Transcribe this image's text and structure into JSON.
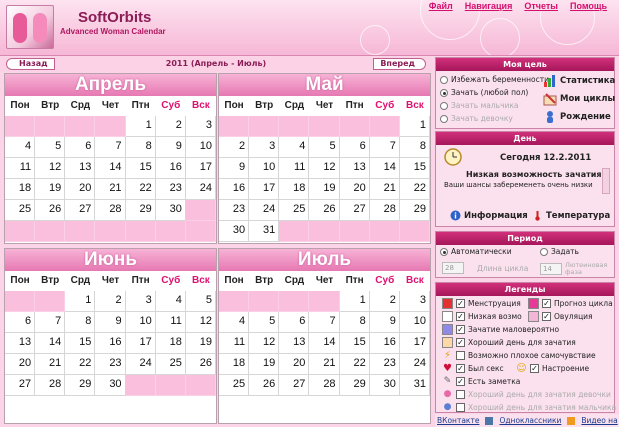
{
  "header": {
    "brand": "SoftOrbits",
    "subtitle": "Advanced Woman Calendar",
    "menu": [
      "Файл",
      "Навигация",
      "Отчеты",
      "Помощь"
    ]
  },
  "nav": {
    "back": "Назад",
    "forward": "Вперед",
    "title": "2011 (Апрель - Июль)"
  },
  "weekdays": [
    "Пон",
    "Втр",
    "Срд",
    "Чет",
    "Птн",
    "Суб",
    "Вск"
  ],
  "months": [
    {
      "name": "Апрель",
      "offset": 4,
      "days": 30,
      "rows": 6
    },
    {
      "name": "Май",
      "offset": 6,
      "days": 31,
      "rows": 6
    },
    {
      "name": "Июнь",
      "offset": 2,
      "days": 30,
      "rows": 5
    },
    {
      "name": "Июль",
      "offset": 4,
      "days": 31,
      "rows": 5
    }
  ],
  "goal": {
    "title": "Моя цель",
    "options": [
      {
        "label": "Избежать беременности",
        "selected": false,
        "enabled": true
      },
      {
        "label": "Зачать (любой пол)",
        "selected": true,
        "enabled": true
      },
      {
        "label": "Зачать мальчика",
        "selected": false,
        "enabled": false
      },
      {
        "label": "Зачать девочку",
        "selected": false,
        "enabled": false
      }
    ],
    "links": [
      "Статистика",
      "Мои циклы",
      "Рождение"
    ]
  },
  "day": {
    "title": "День",
    "today": "Сегодня 12.2.2011",
    "status": "Низкая возможность зачатия",
    "hint": "Ваши шансы забеременеть очень низки",
    "info_link": "Информация",
    "temp_link": "Температура"
  },
  "period": {
    "title": "Период",
    "auto": "Автоматически",
    "manual": "Задать",
    "cycle_value": "28",
    "cycle_label": "Длина цикла",
    "luteal_value": "14",
    "luteal_label": "Лютеиновая фаза"
  },
  "legend": {
    "title": "Легенды",
    "items": [
      {
        "color": "#e33030",
        "label": "Менструация",
        "checked": true
      },
      {
        "color": "#e53b96",
        "label": "Прогноз цикла",
        "checked": true
      },
      {
        "color": "#ffffff",
        "label": "Низкая возмо",
        "checked": true
      },
      {
        "color": "#f4b6d7",
        "label": "Овуляция",
        "checked": true
      },
      {
        "color": "#9189e8",
        "label": "Зачатие маловероятно",
        "checked": true
      },
      {
        "color": "#ffd8a8",
        "label": "Хороший день для зачатия",
        "checked": true
      },
      {
        "icon": "bolt-icon",
        "label": "Возможно плохое самочувствие",
        "checked": false
      },
      {
        "icon": "heart-icon",
        "label": "Был секс",
        "checked": true
      },
      {
        "icon": "smile-icon",
        "label": "Настроение",
        "checked": true
      },
      {
        "icon": "note-icon",
        "label": "Есть заметка",
        "checked": true
      },
      {
        "icon": "pink-icon",
        "label": "Хороший день для зачатия девочки",
        "checked": false,
        "enabled": false
      },
      {
        "icon": "blue-icon",
        "label": "Хороший день для зачатия мальчика",
        "checked": false,
        "enabled": false
      }
    ]
  },
  "footer": {
    "links": [
      "ВКонтакте",
      "Одноклассники",
      "Видео на"
    ]
  }
}
